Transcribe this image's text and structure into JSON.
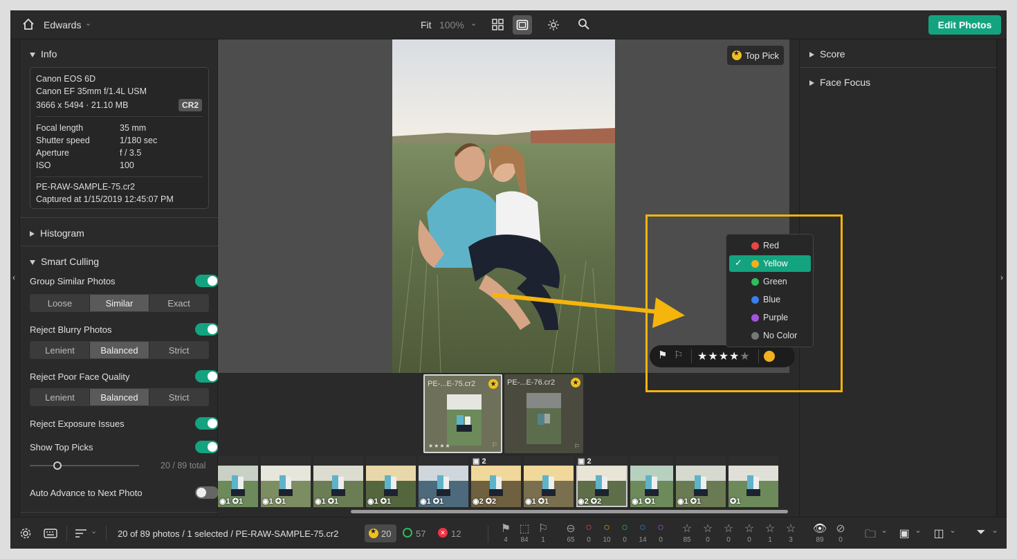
{
  "topbar": {
    "catalog_name": "Edwards",
    "zoom_fit": "Fit",
    "zoom_pct": "100%",
    "edit_button": "Edit Photos"
  },
  "info": {
    "title": "Info",
    "camera": "Canon EOS 6D",
    "lens": "Canon EF 35mm f/1.4L USM",
    "dimensions": "3666 x 5494 · 21.10 MB",
    "format": "CR2",
    "exif": [
      {
        "label": "Focal length",
        "value": "35 mm"
      },
      {
        "label": "Shutter speed",
        "value": "1/180 sec"
      },
      {
        "label": "Aperture",
        "value": "f / 3.5"
      },
      {
        "label": "ISO",
        "value": "100"
      }
    ],
    "filename": "PE-RAW-SAMPLE-75.cr2",
    "captured": "Captured at 1/15/2019 12:45:07 PM"
  },
  "histogram": {
    "title": "Histogram"
  },
  "smart_culling": {
    "title": "Smart Culling",
    "group_similar": {
      "label": "Group Similar Photos",
      "on": true,
      "options": [
        "Loose",
        "Similar",
        "Exact"
      ],
      "selected": "Similar"
    },
    "reject_blurry": {
      "label": "Reject Blurry Photos",
      "on": true,
      "options": [
        "Lenient",
        "Balanced",
        "Strict"
      ],
      "selected": "Balanced"
    },
    "reject_face": {
      "label": "Reject Poor Face Quality",
      "on": true,
      "options": [
        "Lenient",
        "Balanced",
        "Strict"
      ],
      "selected": "Balanced"
    },
    "reject_exposure": {
      "label": "Reject Exposure Issues",
      "on": true
    },
    "top_picks": {
      "label": "Show Top Picks",
      "on": true,
      "count_text": "20",
      "total_text": "/ 89 total",
      "slider_fraction": 0.25
    },
    "auto_advance": {
      "label": "Auto Advance to Next Photo",
      "on": false
    }
  },
  "viewer": {
    "top_pick_label": "Top Pick"
  },
  "right_panel": {
    "score": "Score",
    "face_focus": "Face Focus"
  },
  "color_menu": [
    {
      "label": "Red",
      "color": "#e94545",
      "selected": false
    },
    {
      "label": "Yellow",
      "color": "#f0b020",
      "selected": true
    },
    {
      "label": "Green",
      "color": "#2ebd5a",
      "selected": false
    },
    {
      "label": "Blue",
      "color": "#3a7ee8",
      "selected": false
    },
    {
      "label": "Purple",
      "color": "#a452e0",
      "selected": false
    },
    {
      "label": "No Color",
      "color": "#777777",
      "selected": false
    }
  ],
  "rating": {
    "stars": 4,
    "max": 5,
    "color_label": "#f0b020"
  },
  "group_cards": [
    {
      "name": "PE-...E-75.cr2",
      "stars": "★★★★",
      "selected": true
    },
    {
      "name": "PE-...E-76.cr2",
      "stars": "",
      "selected": false
    }
  ],
  "filmstrip": [
    {
      "meta": "◉1 ✪1",
      "stack": ""
    },
    {
      "meta": "◉1 ✪1",
      "stack": ""
    },
    {
      "meta": "◉1 ✪1",
      "stack": ""
    },
    {
      "meta": "◉1 ✪1",
      "stack": ""
    },
    {
      "meta": "◉1 ✪1",
      "stack": ""
    },
    {
      "meta": "◉2 ✪2",
      "stack": "▣ 2"
    },
    {
      "meta": "◉1 ✪1",
      "stack": ""
    },
    {
      "meta": "◉2 ✪2",
      "stack": "▣ 2"
    },
    {
      "meta": "◉1 ✪1",
      "stack": ""
    },
    {
      "meta": "◉1 ✪1",
      "stack": ""
    },
    {
      "meta": "✪1",
      "stack": ""
    }
  ],
  "status": {
    "summary": "20 of 89 photos / 1 selected / PE-RAW-SAMPLE-75.cr2",
    "top_picks": "20",
    "accepted": "57",
    "rejected": "12",
    "flag_counts": [
      "4",
      "84",
      "1"
    ],
    "color_counts": [
      "65",
      "0",
      "10",
      "0",
      "14",
      "0"
    ],
    "star_counts": [
      "85",
      "0",
      "0",
      "0",
      "1",
      "3"
    ],
    "visible_counts": [
      "89",
      "0"
    ]
  }
}
